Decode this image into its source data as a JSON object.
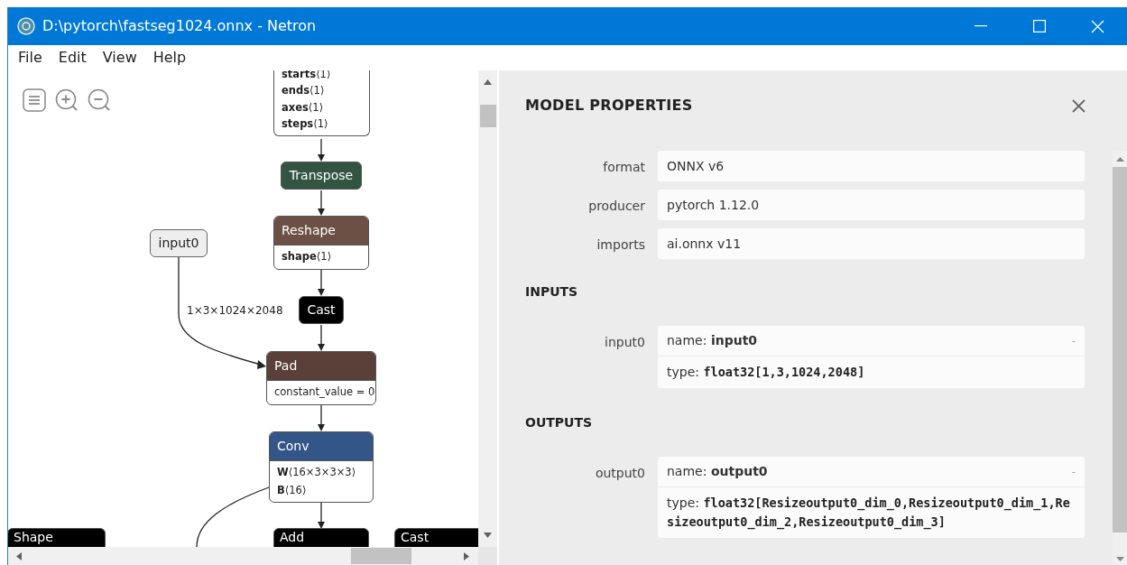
{
  "window": {
    "title": "D:\\pytorch\\fastseg1024.onnx - Netron"
  },
  "menu": [
    "File",
    "Edit",
    "View",
    "Help"
  ],
  "graph": {
    "nodes": [
      {
        "kind": "partial",
        "attributes": [
          {
            "kind": "initializer",
            "name": "starts",
            "value": "⟨1⟩"
          },
          {
            "kind": "initializer",
            "name": "ends",
            "value": "⟨1⟩"
          },
          {
            "kind": "initializer",
            "name": "axes",
            "value": "⟨1⟩"
          },
          {
            "kind": "initializer",
            "name": "steps",
            "value": "⟨1⟩"
          }
        ]
      },
      {
        "kind": "op",
        "title": "Transpose",
        "color": "#335443"
      },
      {
        "kind": "input",
        "title": "input0",
        "color": "#eeeeee"
      },
      {
        "kind": "op",
        "title": "Reshape",
        "color": "#6c4f45",
        "attributes": [
          {
            "kind": "initializer",
            "name": "shape",
            "value": "⟨1⟩"
          }
        ]
      },
      {
        "kind": "op",
        "title": "Cast",
        "color": "#000000"
      },
      {
        "kind": "op",
        "title": "Pad",
        "color": "#5a4039",
        "attributes": [
          {
            "kind": "attribute",
            "text": "constant_value = 0"
          }
        ]
      },
      {
        "kind": "op",
        "title": "Conv",
        "color": "#335587",
        "attributes": [
          {
            "kind": "initializer",
            "name": "W",
            "value": "⟨16×3×3×3⟩"
          },
          {
            "kind": "initializer",
            "name": "B",
            "value": "⟨16⟩"
          }
        ]
      },
      {
        "kind": "op",
        "title": "Shape",
        "color": "#000000"
      },
      {
        "kind": "op",
        "title": "Add",
        "color": "#000000"
      },
      {
        "kind": "op",
        "title": "Cast",
        "color": "#000000"
      }
    ],
    "edge_labels": [
      "1×3×1024×2048"
    ]
  },
  "sidebar": {
    "title": "MODEL PROPERTIES",
    "properties": [
      {
        "label": "format",
        "value": "ONNX v6"
      },
      {
        "label": "producer",
        "value": "pytorch 1.12.0"
      },
      {
        "label": "imports",
        "value": "ai.onnx v11"
      }
    ],
    "sections": [
      {
        "title": "INPUTS",
        "items": [
          {
            "label": "input0",
            "name_key": "name:",
            "name": "input0",
            "type_key": "type:",
            "type": "float32[1,3,1024,2048]",
            "toggle": "-",
            "expanded": true
          }
        ]
      },
      {
        "title": "OUTPUTS",
        "items": [
          {
            "label": "output0",
            "name_key": "name:",
            "name": "output0",
            "type_key": "type:",
            "type": "float32[Resizeoutput0_dim_0,Resizeoutput0_dim_1,Resizeoutput0_dim_2,Resizeoutput0_dim_3]",
            "toggle": "-",
            "expanded": true
          }
        ]
      }
    ]
  }
}
